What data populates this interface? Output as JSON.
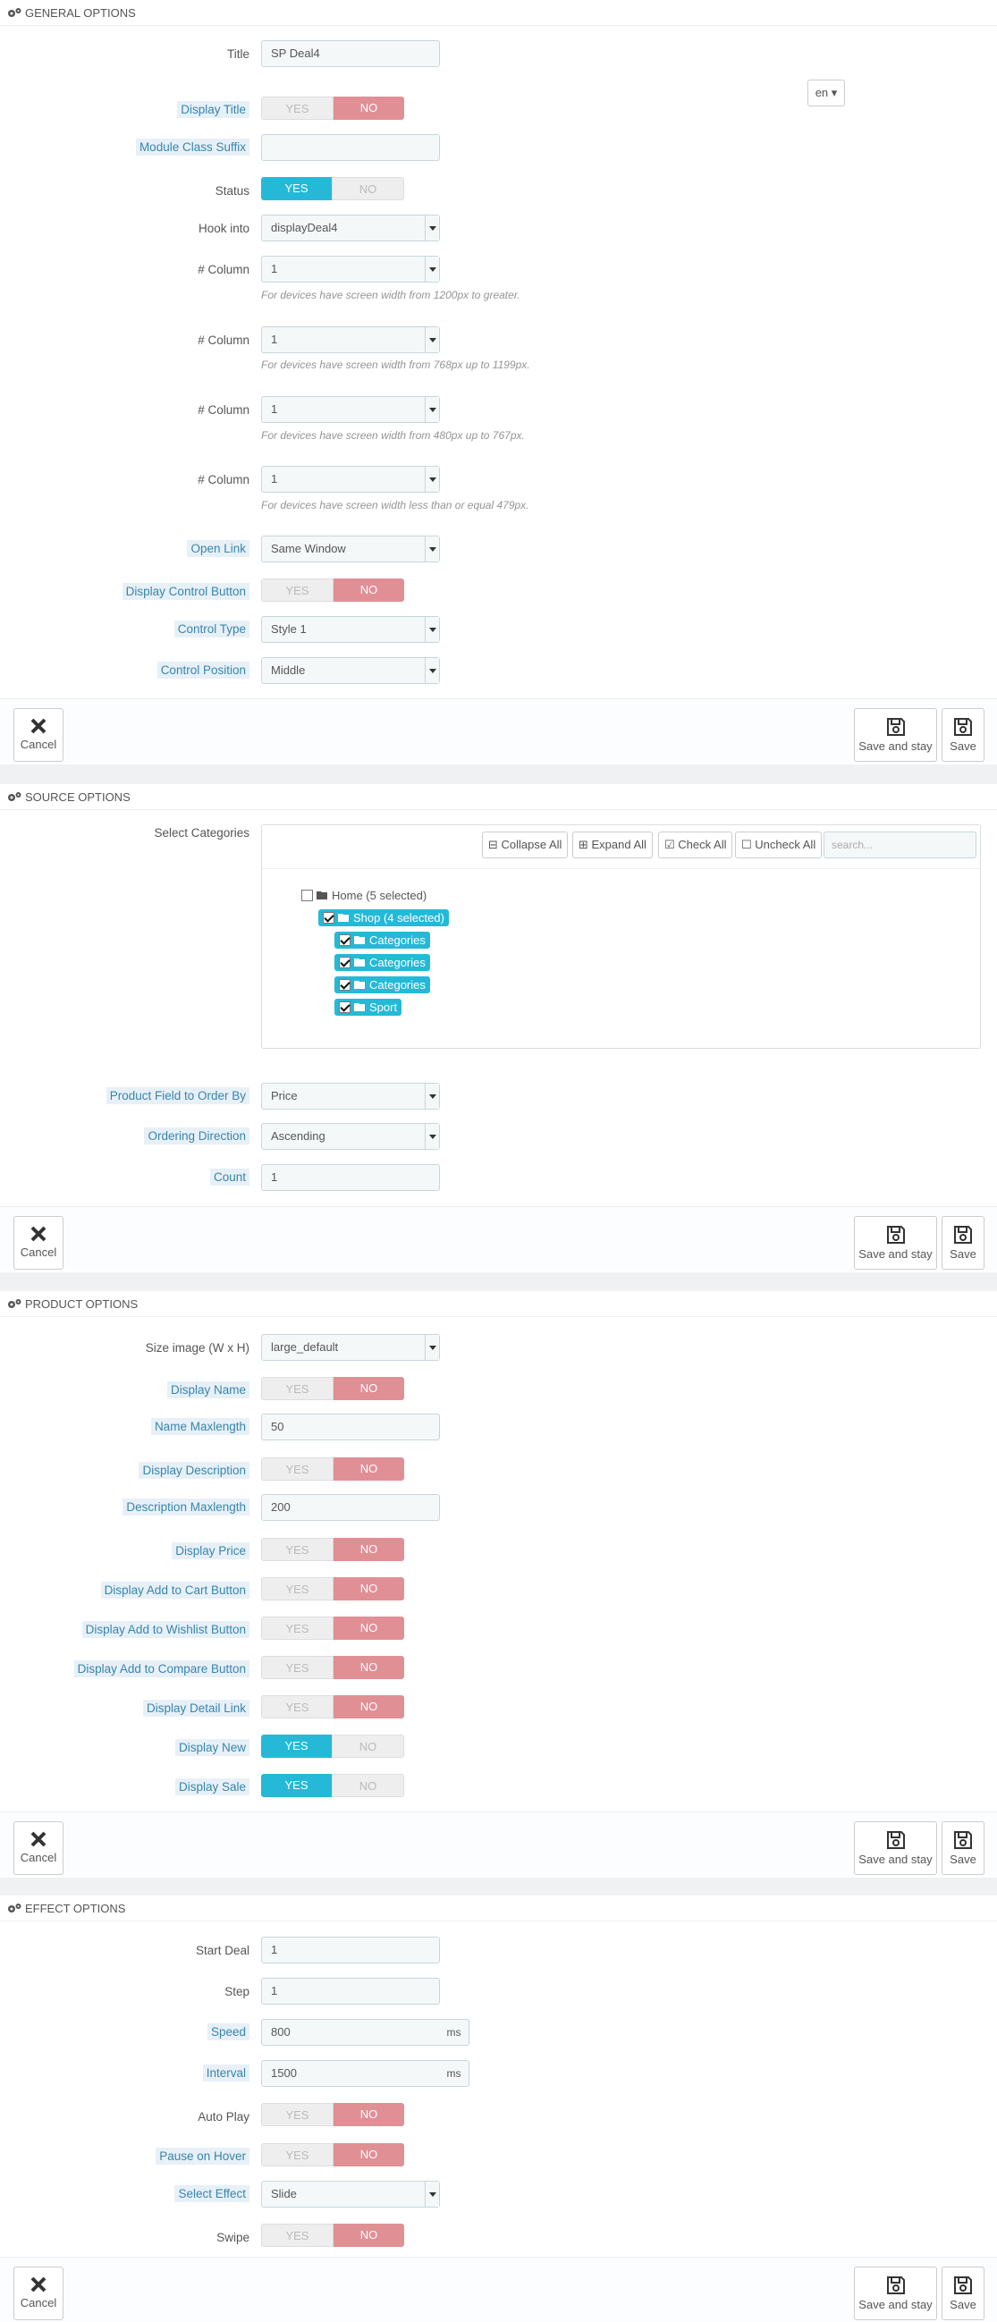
{
  "general": {
    "header": "GENERAL OPTIONS",
    "title_label": "Title",
    "title_value": "SP Deal4",
    "lang": "en",
    "display_title_label": "Display Title",
    "module_class_suffix_label": "Module Class Suffix",
    "module_class_suffix_value": "",
    "status_label": "Status",
    "hook_label": "Hook into",
    "hook_value": "displayDeal4",
    "column_label": "# Column",
    "col1_value": "1",
    "col1_help": "For devices have screen width from 1200px to greater.",
    "col2_value": "1",
    "col2_help": "For devices have screen width from 768px up to 1199px.",
    "col3_value": "1",
    "col3_help": "For devices have screen width from 480px up to 767px.",
    "col4_value": "1",
    "col4_help": "For devices have screen width less than or equal 479px.",
    "open_link_label": "Open Link",
    "open_link_value": "Same Window",
    "display_control_label": "Display Control Button",
    "control_type_label": "Control Type",
    "control_type_value": "Style 1",
    "control_position_label": "Control Position",
    "control_position_value": "Middle"
  },
  "switch": {
    "yes": "YES",
    "no": "NO"
  },
  "buttons": {
    "cancel": "Cancel",
    "save_stay": "Save and stay",
    "save": "Save"
  },
  "source": {
    "header": "SOURCE OPTIONS",
    "select_categories_label": "Select Categories",
    "collapse_all": "Collapse All",
    "expand_all": "Expand All",
    "check_all": "Check All",
    "uncheck_all": "Uncheck All",
    "search_placeholder": "search...",
    "tree": {
      "home": "Home (5 selected)",
      "shop": "Shop (4 selected)",
      "children": [
        "Categories",
        "Categories",
        "Categories",
        "Sport"
      ]
    },
    "order_by_label": "Product Field to Order By",
    "order_by_value": "Price",
    "direction_label": "Ordering Direction",
    "direction_value": "Ascending",
    "count_label": "Count",
    "count_value": "1"
  },
  "product": {
    "header": "PRODUCT OPTIONS",
    "size_image_label": "Size image (W x H)",
    "size_image_value": "large_default",
    "display_name_label": "Display Name",
    "name_maxlength_label": "Name Maxlength",
    "name_maxlength_value": "50",
    "display_description_label": "Display Description",
    "description_maxlength_label": "Description Maxlength",
    "description_maxlength_value": "200",
    "display_price_label": "Display Price",
    "display_cart_label": "Display Add to Cart Button",
    "display_wishlist_label": "Display Add to Wishlist Button",
    "display_compare_label": "Display Add to Compare Button",
    "display_detail_label": "Display Detail Link",
    "display_new_label": "Display New",
    "display_sale_label": "Display Sale"
  },
  "effect": {
    "header": "EFFECT OPTIONS",
    "start_deal_label": "Start Deal",
    "start_deal_value": "1",
    "step_label": "Step",
    "step_value": "1",
    "speed_label": "Speed",
    "speed_value": "800",
    "interval_label": "Interval",
    "interval_value": "1500",
    "unit": "ms",
    "autoplay_label": "Auto Play",
    "pause_label": "Pause on Hover",
    "select_effect_label": "Select Effect",
    "select_effect_value": "Slide",
    "swipe_label": "Swipe"
  },
  "colors": {
    "accent": "#25b9d7",
    "no": "#e08f95",
    "hint_bg": "#e8f0f7",
    "hint_text": "#3586ae"
  }
}
